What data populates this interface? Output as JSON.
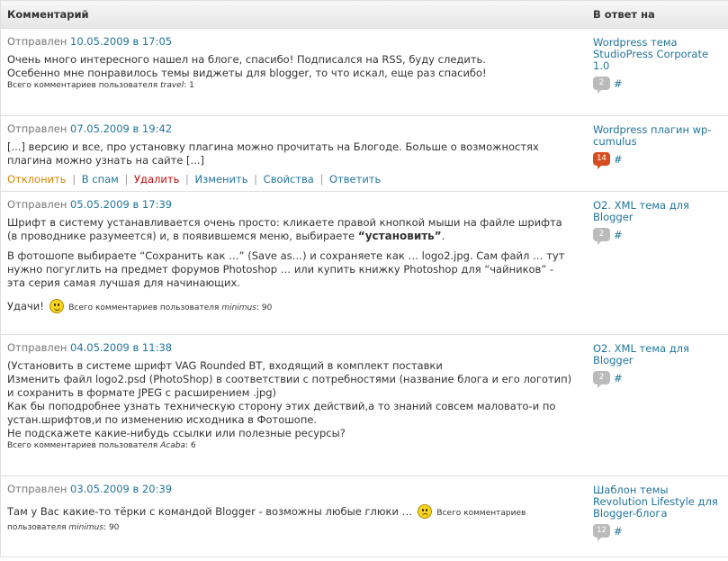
{
  "header": {
    "comment_col": "Комментарий",
    "response_col": "В ответ на"
  },
  "sent_label": "Отправлен",
  "total_label": "Всего комментариев пользователя",
  "actions": {
    "reject": "Отклонить",
    "spam": "В спам",
    "delete": "Удалить",
    "edit": "Изменить",
    "properties": "Свойства",
    "reply": "Ответить",
    "separator": "|"
  },
  "comments": [
    {
      "date": "10.05.2009 в 17:05",
      "lines": [
        "Очень много интересного нашел на блоге, спасибо! Подписался на RSS, буду следить.",
        "Осебенно мне понравилось темы виджеты для blogger, то что искал, еще раз спасибо!"
      ],
      "user": "travel",
      "user_count": "1",
      "post_title": "Wordpress тема StudioPress Corporate 1.0",
      "post_count": "2",
      "hash": "#"
    },
    {
      "date": "07.05.2009 в 19:42",
      "lines": [
        "[...] версию и все, про установку плагина можно прочитать на Блогоде. Больше о возможностях плагина можно узнать на сайте [...]"
      ],
      "post_title": "Wordpress плагин wp-cumulus",
      "post_count": "14",
      "hash": "#"
    },
    {
      "date": "05.05.2009 в 17:39",
      "p1": "Шрифт в систему устанавливается очень просто: кликаете правой кнопкой мыши на файле шрифта (в проводнике разумеется) и, в появившемся меню, выбираете",
      "p1_strong": "“установить”",
      "p1_end": ".",
      "p2": "В фотошопе выбираете “Сохранить как …” (Save as…) и сохраняете как … logo2.jpg. Сам файл … тут нужно погуглить на предмет форумов Photoshop … или купить книжку Photoshop для “чайников” - эта серия самая лучшая для начинающих.",
      "p3": "Удачи!",
      "user": "minimus",
      "user_count": "90",
      "post_title": "O2. XML тема для Blogger",
      "post_count": "2",
      "hash": "#"
    },
    {
      "date": "04.05.2009 в 11:38",
      "lines": [
        "(Установить в системе шрифт VAG Rounded BT, входящий в комплект поставки",
        "Изменить файл logo2.psd (PhotoShop) в соответствии с потребностями (название блога и его логотип) и сохранить в формате JPEG с расширением .jpg)",
        "Как бы поподробнее узнать техническую сторону этих действий,а то знаний совсем маловато-и по устан.шрифтов,и по изменению исходника в Фотошопе.",
        "Не подскажете какие-нибудь ссылки или полезные ресурсы?"
      ],
      "user": "Acaba",
      "user_count": "6",
      "post_title": "O2. XML тема для Blogger",
      "post_count": "2",
      "hash": "#"
    },
    {
      "date": "03.05.2009 в 20:39",
      "text": "Там у Вас какие-то тёрки с командой Blogger - возможны любые глюки …",
      "user": "minimus",
      "user_count": "90",
      "post_title": "Шаблон темы Revolution Lifestyle для Blogger-блога",
      "post_count": "12",
      "hash": "#"
    }
  ]
}
